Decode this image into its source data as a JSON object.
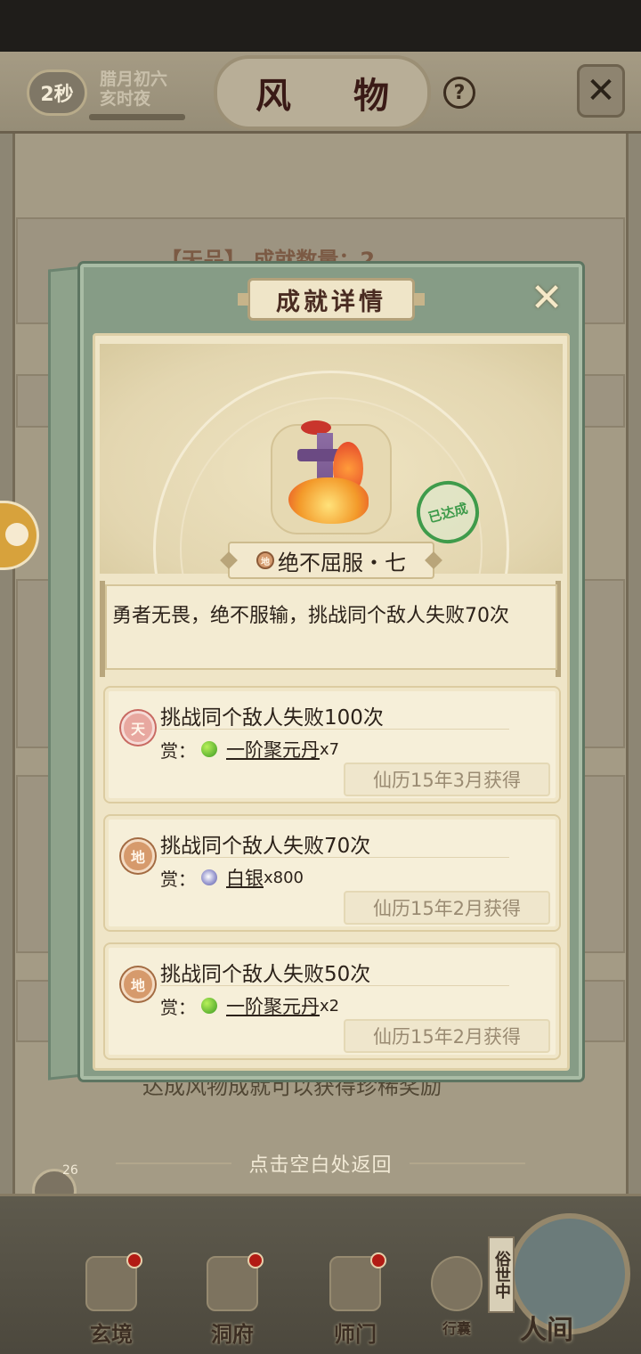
{
  "header": {
    "timer": "2秒",
    "date_line1": "腊月初六",
    "date_line2": "亥时夜",
    "title": "风 物",
    "help_icon": "question-icon",
    "close_icon": "close-x-icon"
  },
  "background": {
    "tier_label": "【天品】 成就数量：2",
    "hint": "达成风物成就可以获得珍稀奖励",
    "return_hint": "点击空白处返回",
    "chat_count": "26"
  },
  "bottom_nav": {
    "items": [
      {
        "label": "玄境",
        "icon": "scroll-icon"
      },
      {
        "label": "洞府",
        "icon": "pavilion-icon"
      },
      {
        "label": "师门",
        "icon": "banner-icon"
      },
      {
        "label": "行囊",
        "icon": "bag-icon"
      }
    ],
    "world_tag": "俗世中",
    "world_label": "人间"
  },
  "modal": {
    "title": "成就详情",
    "close_icon": "close-x-icon",
    "stamp": "已达成",
    "achievement_grade": "地",
    "achievement_name": "绝不屈服・七",
    "description": "勇者无畏，绝不服输，挑战同个敌人失败70次",
    "entries": [
      {
        "grade": "天",
        "grade_class": "tian",
        "title": "挑战同个敌人失败100次",
        "reward_prefix": "赏：",
        "reward_icon": "pill",
        "reward_name": "一阶聚元丹",
        "reward_qty": "x7",
        "time": "仙历15年3月获得"
      },
      {
        "grade": "地",
        "grade_class": "di",
        "title": "挑战同个敌人失败70次",
        "reward_prefix": "赏：",
        "reward_icon": "silver",
        "reward_name": "白银",
        "reward_qty": "x800",
        "time": "仙历15年2月获得"
      },
      {
        "grade": "地",
        "grade_class": "di",
        "title": "挑战同个敌人失败50次",
        "reward_prefix": "赏：",
        "reward_icon": "pill",
        "reward_name": "一阶聚元丹",
        "reward_qty": "x2",
        "time": "仙历15年2月获得"
      }
    ]
  }
}
